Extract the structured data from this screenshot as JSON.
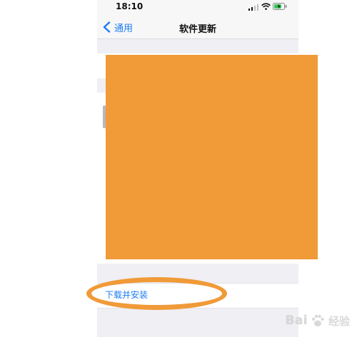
{
  "status_bar": {
    "time": "18:10",
    "icons": [
      "signal-icon",
      "wifi-icon",
      "battery-icon"
    ]
  },
  "nav": {
    "back_label": "通用",
    "title": "软件更新",
    "back_icon": "chevron-left-icon"
  },
  "content": {
    "download_label": "下载并安装"
  },
  "overlay": {
    "redaction_color": "#f09a38",
    "highlight_color": "#f09a38"
  },
  "watermark": {
    "text_left": "Bai",
    "text_right": "经验",
    "icon": "paw-icon"
  },
  "colors": {
    "accent": "#1c7cf4",
    "background": "#efeff4"
  }
}
